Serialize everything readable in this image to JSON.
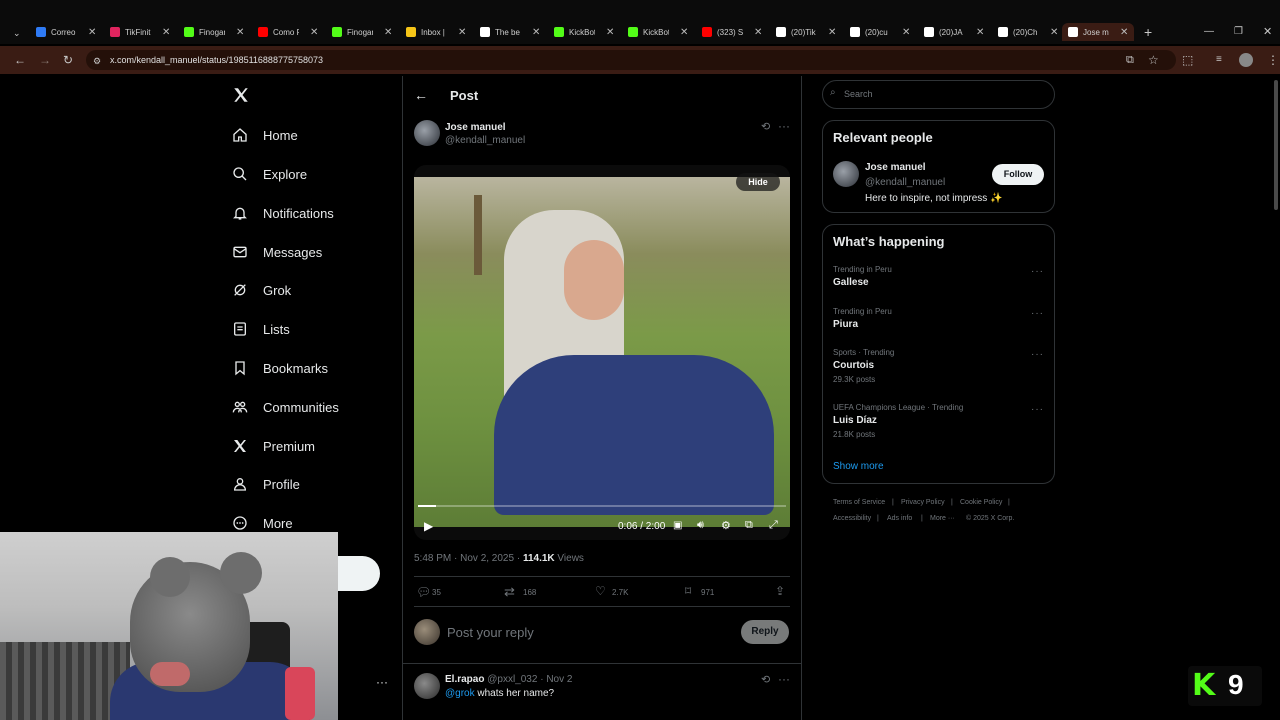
{
  "browser": {
    "tabs": [
      {
        "label": "Correo",
        "color": "#2f7bf5"
      },
      {
        "label": "TikFinit",
        "color": "#e0245e"
      },
      {
        "label": "Finogam",
        "color": "#53fc18"
      },
      {
        "label": "Como F",
        "color": "#ff0000"
      },
      {
        "label": "Finogam",
        "color": "#53fc18"
      },
      {
        "label": "Inbox |",
        "color": "#f5c518"
      },
      {
        "label": "The be",
        "color": "#ffffff"
      },
      {
        "label": "KickBot",
        "color": "#53fc18"
      },
      {
        "label": "KickBot",
        "color": "#53fc18"
      },
      {
        "label": "(323) S",
        "color": "#ff0000"
      },
      {
        "label": "(20)Tik",
        "color": "#ffffff"
      },
      {
        "label": "(20)cu",
        "color": "#ffffff"
      },
      {
        "label": "(20)JA",
        "color": "#ffffff"
      },
      {
        "label": "(20)Ch",
        "color": "#ffffff"
      },
      {
        "label": "Jose m",
        "color": "#ffffff"
      }
    ],
    "url": "x.com/kendall_manuel/status/1985116888775758073"
  },
  "nav": {
    "items": [
      {
        "label": "Home",
        "icon": "home-icon"
      },
      {
        "label": "Explore",
        "icon": "search-icon"
      },
      {
        "label": "Notifications",
        "icon": "bell-icon"
      },
      {
        "label": "Messages",
        "icon": "envelope-icon"
      },
      {
        "label": "Grok",
        "icon": "grok-icon"
      },
      {
        "label": "Lists",
        "icon": "list-icon"
      },
      {
        "label": "Bookmarks",
        "icon": "bookmark-icon"
      },
      {
        "label": "Communities",
        "icon": "communities-icon"
      },
      {
        "label": "Premium",
        "icon": "x-logo-icon"
      },
      {
        "label": "Profile",
        "icon": "person-icon"
      },
      {
        "label": "More",
        "icon": "more-circle-icon"
      }
    ],
    "account_more": "···"
  },
  "post": {
    "header_title": "Post",
    "author_name": "Jose manuel",
    "author_handle": "@kendall_manuel",
    "hide_label": "Hide",
    "video_time": "0:06 / 2:00",
    "video_progress": 0.05,
    "timestamp": "5:48 PM · Nov 2, 2025 · ",
    "views_count": "114.1K",
    "views_label": " Views",
    "replies": "35",
    "reposts": "168",
    "likes": "2.7K",
    "bookmarks": "971",
    "reply_placeholder": "Post your reply",
    "reply_button": "Reply"
  },
  "reply_comment": {
    "author_name": "El.rapao",
    "meta": "@pxxl_032 · Nov 2",
    "mention": "@grok",
    "text": " whats her name?"
  },
  "sidebar": {
    "search_placeholder": "Search",
    "relevant_title": "Relevant people",
    "person_name": "Jose manuel",
    "person_handle": "@kendall_manuel",
    "follow_label": "Follow",
    "person_bio": "Here to inspire, not impress ✨",
    "happening_title": "What’s happening",
    "trends": [
      {
        "meta": "Trending in Peru",
        "title": "Gallese",
        "count": ""
      },
      {
        "meta": "Trending in Peru",
        "title": "Piura",
        "count": ""
      },
      {
        "meta": "Sports · Trending",
        "title": "Courtois",
        "count": "29.3K posts"
      },
      {
        "meta": "UEFA Champions League · Trending",
        "title": "Luis Díaz",
        "count": "21.8K posts"
      }
    ],
    "show_more": "Show more",
    "footer": {
      "terms": "Terms of Service",
      "privacy": "Privacy Policy",
      "cookie": "Cookie Policy",
      "accessibility": "Accessibility",
      "ads": "Ads info",
      "more": "More ···",
      "copyright": "© 2025 X Corp."
    }
  },
  "overlay": {
    "kick_number": "9",
    "kick_color": "#53fc18"
  }
}
